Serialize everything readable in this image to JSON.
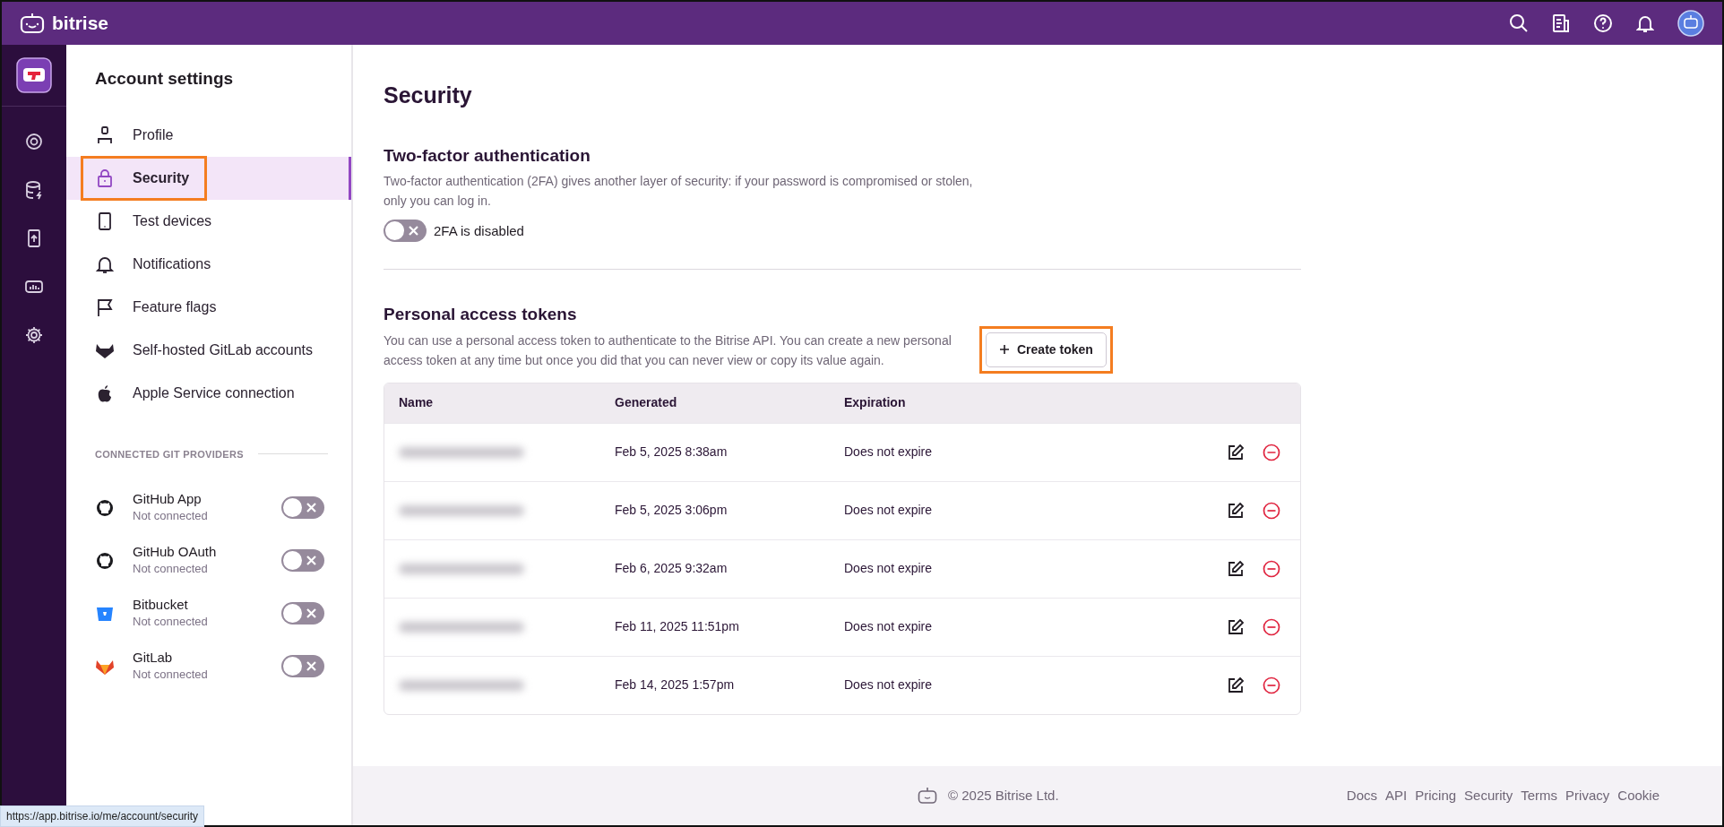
{
  "topbar": {
    "brand": "bitrise"
  },
  "sidebar": {
    "title": "Account settings",
    "items": [
      {
        "label": "Profile",
        "selected": false,
        "highlighted": false
      },
      {
        "label": "Security",
        "selected": true,
        "highlighted": true
      },
      {
        "label": "Test devices",
        "selected": false,
        "highlighted": false
      },
      {
        "label": "Notifications",
        "selected": false,
        "highlighted": false
      },
      {
        "label": "Feature flags",
        "selected": false,
        "highlighted": false
      },
      {
        "label": "Self-hosted GitLab accounts",
        "selected": false,
        "highlighted": false
      },
      {
        "label": "Apple Service connection",
        "selected": false,
        "highlighted": false
      }
    ],
    "section_label": "CONNECTED GIT PROVIDERS",
    "providers": [
      {
        "name": "GitHub App",
        "status": "Not connected",
        "on": false
      },
      {
        "name": "GitHub OAuth",
        "status": "Not connected",
        "on": false
      },
      {
        "name": "Bitbucket",
        "status": "Not connected",
        "on": false
      },
      {
        "name": "GitLab",
        "status": "Not connected",
        "on": false
      }
    ]
  },
  "main": {
    "title": "Security",
    "two_factor": {
      "heading": "Two-factor authentication",
      "description": "Two-factor authentication (2FA) gives another layer of security: if your password is compromised or stolen, only you can log in.",
      "toggle_label": "2FA is disabled",
      "on": false
    },
    "tokens": {
      "heading": "Personal access tokens",
      "description": "You can use a personal access token to authenticate to the Bitrise API. You can create a new personal access token at any time but once you did that you can never view or copy its value again.",
      "create_button": {
        "label": "Create token",
        "highlighted": true
      },
      "table": {
        "columns": [
          "Name",
          "Generated",
          "Expiration"
        ],
        "rows": [
          {
            "generated": "Feb 5, 2025 8:38am",
            "expiration": "Does not expire"
          },
          {
            "generated": "Feb 5, 2025 3:06pm",
            "expiration": "Does not expire"
          },
          {
            "generated": "Feb 6, 2025 9:32am",
            "expiration": "Does not expire"
          },
          {
            "generated": "Feb 11, 2025 11:51pm",
            "expiration": "Does not expire"
          },
          {
            "generated": "Feb 14, 2025 1:57pm",
            "expiration": "Does not expire"
          }
        ]
      }
    }
  },
  "footer": {
    "copyright": "© 2025 Bitrise Ltd.",
    "links": [
      "Docs",
      "API",
      "Pricing",
      "Security",
      "Terms",
      "Privacy",
      "Cookie"
    ]
  },
  "status_url": "https://app.bitrise.io/me/account/security"
}
